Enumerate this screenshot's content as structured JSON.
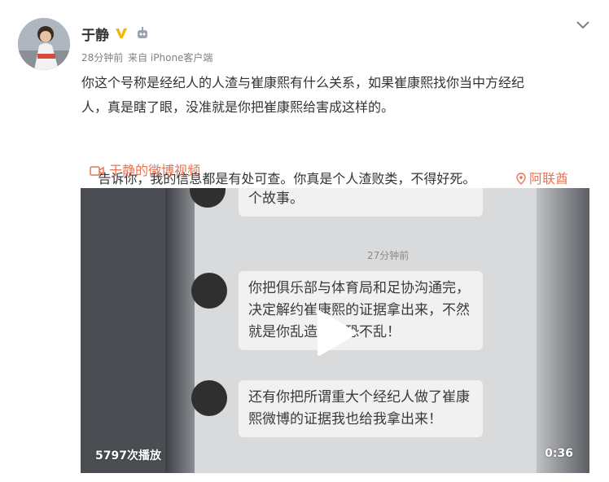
{
  "post": {
    "user": {
      "name": "于静",
      "verified_icon": "verified-v-icon",
      "member_icon": "robot-badge-icon"
    },
    "meta": {
      "time": "28分钟前",
      "source": "来自 iPhone客户端"
    },
    "text": {
      "line1": "你这个号称是经纪人的人渣与崔康熙有什么关系，如果崔康熙找你当中方经纪",
      "line2": "人，真是瞎了眼，没准就是你把崔康熙给害成这样的。",
      "line3": "告诉你，我的信息都是有处可查。你真是个人渣败类，不得好死。",
      "location": "阿联酋"
    },
    "video_link": "于静的微博视频",
    "video": {
      "play_count": "5797次播放",
      "duration": "0:36",
      "screen": {
        "top_bubble": "个故事。",
        "timestamp": "27分钟前",
        "bubble1": "你把俱乐部与体育局和足协沟通完，决定解约崔康熙的证据拿出来，不然就是你乱造！唯恐不乱！",
        "bubble2": "还有你把所谓重大个经纪人做了崔康熙微博的证据我也给我拿出来！"
      }
    },
    "colors": {
      "accent": "#eb7350",
      "verified": "#f7b500",
      "text": "#333333",
      "meta": "#808080"
    }
  }
}
